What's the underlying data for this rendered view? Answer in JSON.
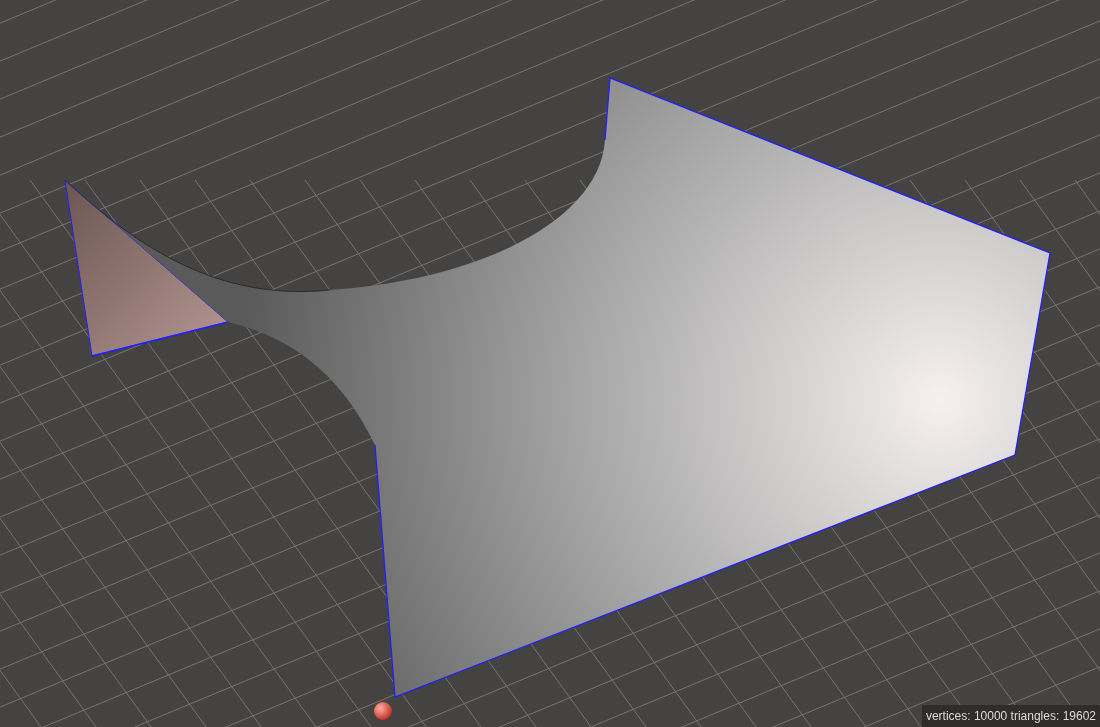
{
  "viewport": {
    "status": "vertices: 10000 triangles: 19602"
  }
}
